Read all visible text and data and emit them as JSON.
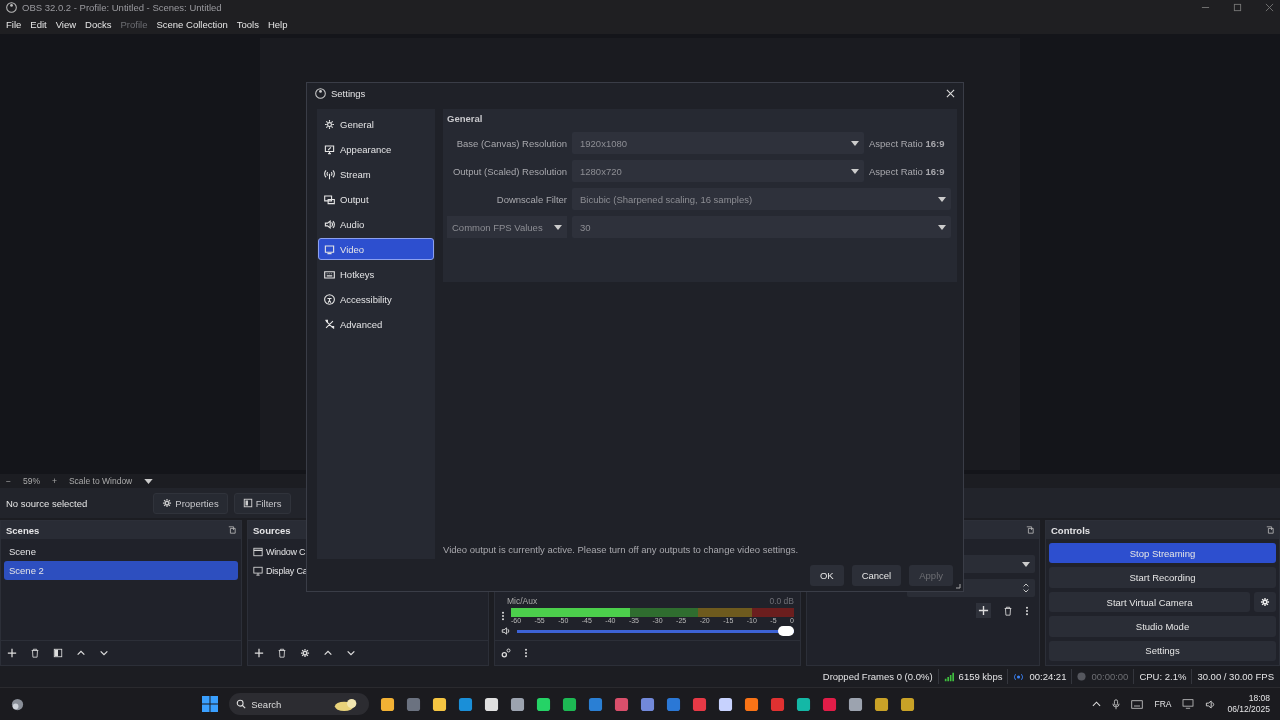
{
  "window": {
    "title": "OBS 32.0.2 - Profile: Untitled - Scenes: Untitled"
  },
  "menu": [
    {
      "label": "File",
      "disabled": false
    },
    {
      "label": "Edit",
      "disabled": false
    },
    {
      "label": "View",
      "disabled": false
    },
    {
      "label": "Docks",
      "disabled": false
    },
    {
      "label": "Profile",
      "disabled": true
    },
    {
      "label": "Scene Collection",
      "disabled": false
    },
    {
      "label": "Tools",
      "disabled": false
    },
    {
      "label": "Help",
      "disabled": false
    }
  ],
  "preview_toolbar": {
    "zoom_out": "−",
    "zoom": "59%",
    "zoom_in": "+",
    "scale_mode": "Scale to Window"
  },
  "source_bar": {
    "status": "No source selected",
    "properties": "Properties",
    "filters": "Filters"
  },
  "scenes": {
    "title": "Scenes",
    "items": [
      {
        "label": "Scene",
        "selected": false
      },
      {
        "label": "Scene 2",
        "selected": true
      }
    ]
  },
  "sources": {
    "title": "Sources",
    "items": [
      {
        "label": "Window C",
        "kind": "window"
      },
      {
        "label": "Display Ca",
        "kind": "display"
      }
    ]
  },
  "mixer": {
    "channels": [
      {
        "name": "Mic/Aux",
        "reading": "0.0 dB",
        "level": 0.42,
        "volume": {
          "level": 1
        },
        "ticks": [
          "-60",
          "-55",
          "-50",
          "-45",
          "-40",
          "-35",
          "-30",
          "-25",
          "-20",
          "-15",
          "-10",
          "-5",
          "0"
        ]
      }
    ]
  },
  "controls": {
    "title": "Controls",
    "buttons": [
      {
        "label": "Stop Streaming",
        "active": true,
        "has_settings": false
      },
      {
        "label": "Start Recording",
        "active": false,
        "has_settings": false
      },
      {
        "label": "Start Virtual Camera",
        "active": false,
        "has_settings": true
      },
      {
        "label": "Studio Mode",
        "active": false,
        "has_settings": false
      },
      {
        "label": "Settings",
        "active": false,
        "has_settings": false
      }
    ]
  },
  "status_bar": {
    "dropped_frames": "Dropped Frames 0 (0.0%)",
    "bitrate": "6159 kbps",
    "stream_time": "00:24:21",
    "record_time": "00:00:00",
    "cpu": "CPU: 2.1%",
    "fps": "30.00 / 30.00 FPS"
  },
  "settings": {
    "title": "Settings",
    "nav": [
      {
        "label": "General",
        "selected": false
      },
      {
        "label": "Appearance",
        "selected": false
      },
      {
        "label": "Stream",
        "selected": false
      },
      {
        "label": "Output",
        "selected": false
      },
      {
        "label": "Audio",
        "selected": false
      },
      {
        "label": "Video",
        "selected": true
      },
      {
        "label": "Hotkeys",
        "selected": false
      },
      {
        "label": "Accessibility",
        "selected": false
      },
      {
        "label": "Advanced",
        "selected": false
      }
    ],
    "section": "General",
    "disabled": true,
    "rows": [
      {
        "kind": "resolution",
        "label": "Base (Canvas) Resolution",
        "value": "1920x1080",
        "aspect": "Aspect Ratio **16:9**"
      },
      {
        "kind": "resolution",
        "label": "Output (Scaled) Resolution",
        "value": "1280x720",
        "aspect": "Aspect Ratio **16:9**"
      },
      {
        "kind": "select",
        "label": "Downscale Filter",
        "value": "Bicubic (Sharpened scaling, 16 samples)"
      },
      {
        "kind": "fps",
        "label": "Common FPS Values",
        "value": "30"
      }
    ],
    "notice": "Video output is currently active. Please turn off any outputs to change video settings.",
    "buttons": [
      {
        "label": "OK",
        "disabled": false
      },
      {
        "label": "Cancel",
        "disabled": false
      },
      {
        "label": "Apply",
        "disabled": true
      }
    ]
  },
  "taskbar": {
    "search": {
      "placeholder": "Search"
    },
    "language": "FRA",
    "time": "18:08",
    "date": "06/12/2025"
  }
}
